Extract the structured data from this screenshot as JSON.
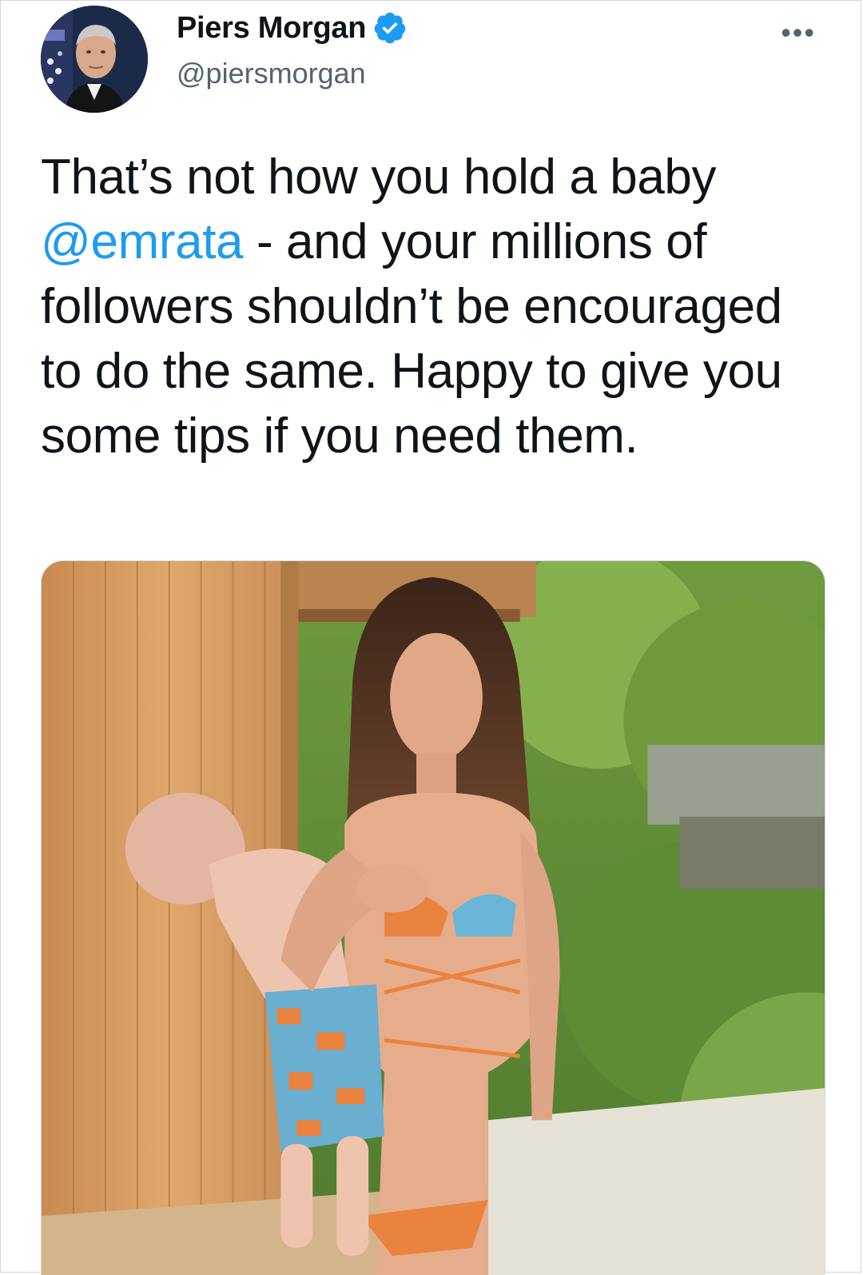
{
  "tweet": {
    "display_name": "Piers Morgan",
    "handle": "@piersmorgan",
    "more_icon": "more-horizontal-icon",
    "verified_icon": "verified-badge-icon",
    "text_before_mention": "That’s not how you hold a baby",
    "mention": "@emrata",
    "text_after_mention": "- and your millions of followers shouldn’t be encouraged to do the same. Happy to give you some tips if you need them."
  },
  "colors": {
    "mention": "#1d9bf0",
    "verified": "#1d9bf0",
    "handle": "#536471",
    "text": "#0f1419"
  }
}
